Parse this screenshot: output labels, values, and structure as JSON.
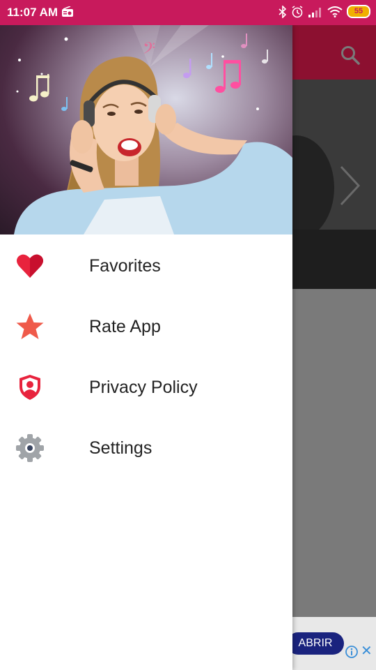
{
  "status_bar": {
    "time": "11:07 AM",
    "battery": "55"
  },
  "drawer": {
    "menu": [
      {
        "label": "Favorites",
        "icon": "heart-icon"
      },
      {
        "label": "Rate App",
        "icon": "star-icon"
      },
      {
        "label": "Privacy Policy",
        "icon": "shield-user-icon"
      },
      {
        "label": "Settings",
        "icon": "gear-icon"
      }
    ]
  },
  "ad": {
    "button_label": "ABRIR"
  },
  "colors": {
    "status_bar": "#c81a5c",
    "accent_red": "#e8233d",
    "star_coral": "#ef5a4a",
    "gear_gray": "#a0a4a8"
  }
}
